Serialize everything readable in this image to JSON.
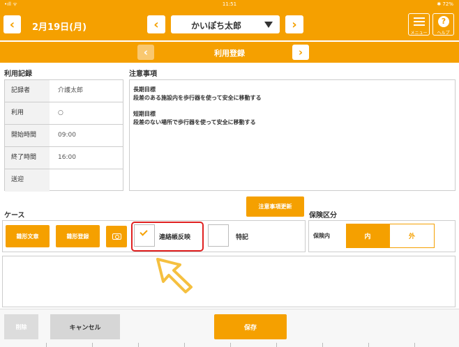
{
  "status_bar": {
    "left": "•ıll ᯤ",
    "time": "11:51",
    "battery": "✱ 72%"
  },
  "header": {
    "date": "2月19日(月)",
    "user_name": "かいぽち太郎",
    "menu_label": "メニュー",
    "help_label": "ヘルプ",
    "help_glyph": "?"
  },
  "subheader": {
    "title": "利用登録"
  },
  "usage_record": {
    "title": "利用記録",
    "rows": [
      {
        "key": "記録者",
        "value": "介護太郎"
      },
      {
        "key": "利用",
        "value": "○"
      },
      {
        "key": "開始時間",
        "value": "09:00"
      },
      {
        "key": "終了時間",
        "value": "16:00"
      },
      {
        "key": "送迎",
        "value": ""
      }
    ]
  },
  "notes": {
    "title": "注意事項",
    "long_term_heading": "長期目標",
    "long_term_text": "段差のある施設内を歩行器を使って安全に移動する",
    "short_term_heading": "短期目標",
    "short_term_text": "段差のない場所で歩行器を使って安全に移動する",
    "update_button": "注意事項更新"
  },
  "case": {
    "title": "ケース",
    "template_text_button": "雛形文章",
    "template_register_button": "雛形登録",
    "renraku_label": "連絡帳反映",
    "renraku_checked": true,
    "tokki_label": "特記",
    "tokki_checked": false
  },
  "insurance": {
    "title": "保険区分",
    "label": "保険内",
    "option_in": "内",
    "option_out": "外",
    "selected": "内"
  },
  "footer": {
    "delete_button": "削除",
    "cancel_button": "キャンセル",
    "save_button": "保存"
  },
  "colors": {
    "accent": "#f5a000",
    "highlight": "#e02020",
    "arrow": "#f5c040"
  }
}
